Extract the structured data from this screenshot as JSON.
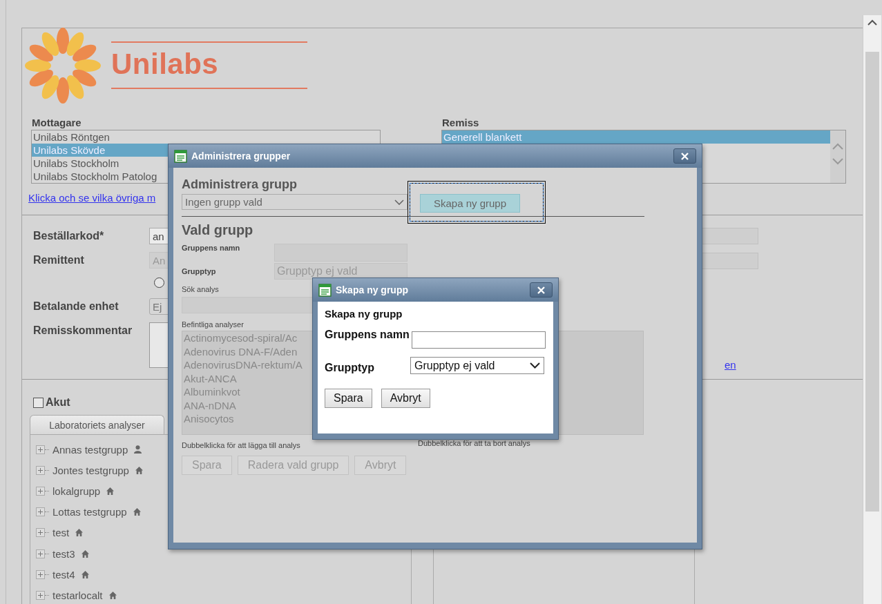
{
  "logo": {
    "text": "Unilabs"
  },
  "mottagare": {
    "legend": "Mottagare",
    "items": [
      {
        "label": "Unilabs Röntgen",
        "selected": false
      },
      {
        "label": "Unilabs Skövde",
        "selected": true
      },
      {
        "label": "Unilabs Stockholm",
        "selected": false
      },
      {
        "label": "Unilabs Stockholm Patolog",
        "selected": false
      }
    ],
    "link": "Klicka och se vilka övriga m"
  },
  "remiss": {
    "legend": "Remiss",
    "items": [
      {
        "label": "Generell blankett",
        "selected": true
      }
    ]
  },
  "form": {
    "fields": [
      {
        "label": "Beställarkod*",
        "value": "an",
        "disabled": false
      },
      {
        "label": "Remittent",
        "value": "An",
        "disabled": true
      }
    ],
    "radio": {
      "selected": false
    },
    "payer": {
      "label": "Betalande enhet",
      "value": "Ej"
    },
    "comment": {
      "label": "Remisskommentar"
    },
    "link": "en"
  },
  "akut": {
    "label": "Akut",
    "checked": false
  },
  "tabs": [
    {
      "label": "Laboratoriets analyser",
      "selected": true
    }
  ],
  "tree": [
    {
      "label": "Annas testgrupp",
      "kind": "personal"
    },
    {
      "label": "Jontes testgrupp",
      "kind": "shared"
    },
    {
      "label": "lokalgrupp",
      "kind": "shared"
    },
    {
      "label": "Lottas testgrupp",
      "kind": "shared"
    },
    {
      "label": "test",
      "kind": "shared"
    },
    {
      "label": "test3",
      "kind": "shared"
    },
    {
      "label": "test4",
      "kind": "shared"
    },
    {
      "label": "testarlocalt",
      "kind": "shared"
    }
  ],
  "admin_dialog": {
    "title": "Administrera grupper",
    "heading": "Administrera grupp",
    "group_select": "Ingen grupp vald",
    "create_button": {
      "label": "Skapa ny grupp",
      "focused": true
    },
    "section": "Vald grupp",
    "name_label": "Gruppens namn",
    "type_label": "Grupptyp",
    "type_value": "Grupptyp ej vald",
    "search_label": "Sök analys",
    "existing_label": "Befintliga analyser",
    "existing": [
      "Actinomycesod-spiral/Ac",
      "Adenovirus DNA-F/Aden",
      "AdenovirusDNA-rektum/A",
      "Akut-ANCA",
      "Albuminkvot",
      "ANA-nDNA",
      "Anisocytos"
    ],
    "hint_add": "Dubbelklicka för att lägga till analys",
    "hint_remove": "Dubbelklicka för att ta bort analys",
    "buttons": [
      {
        "label": "Spara",
        "disabled": true
      },
      {
        "label": "Radera vald grupp",
        "disabled": true
      },
      {
        "label": "Avbryt",
        "disabled": true
      }
    ]
  },
  "create_dialog": {
    "title": "Skapa ny grupp",
    "heading": "Skapa ny grupp",
    "name_label": "Gruppens namn",
    "type_label": "Grupptyp",
    "type_value": "Grupptyp ej vald",
    "buttons": [
      {
        "label": "Spara"
      },
      {
        "label": "Avbryt"
      }
    ]
  }
}
